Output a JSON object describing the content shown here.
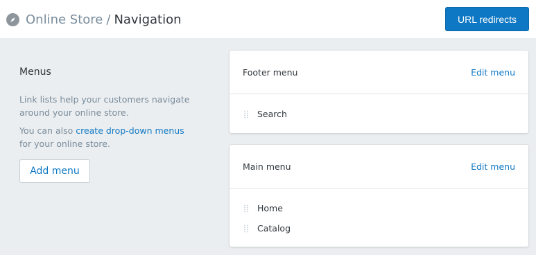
{
  "header": {
    "app_icon": "compass-icon",
    "breadcrumb_parent": "Online Store",
    "breadcrumb_separator": "/",
    "page_title": "Navigation",
    "url_redirects_label": "URL redirects"
  },
  "sidebar": {
    "heading": "Menus",
    "description": "Link lists help your customers navigate around your online store.",
    "also_prefix": "You can also ",
    "also_link": "create drop-down menus",
    "also_suffix": "for your online store.",
    "add_menu_label": "Add menu"
  },
  "menus": [
    {
      "title": "Footer menu",
      "edit_label": "Edit menu",
      "items": [
        "Search"
      ]
    },
    {
      "title": "Main menu",
      "edit_label": "Edit menu",
      "items": [
        "Home",
        "Catalog"
      ]
    }
  ],
  "colors": {
    "accent": "#0f78c4",
    "background": "#ebeef0"
  }
}
